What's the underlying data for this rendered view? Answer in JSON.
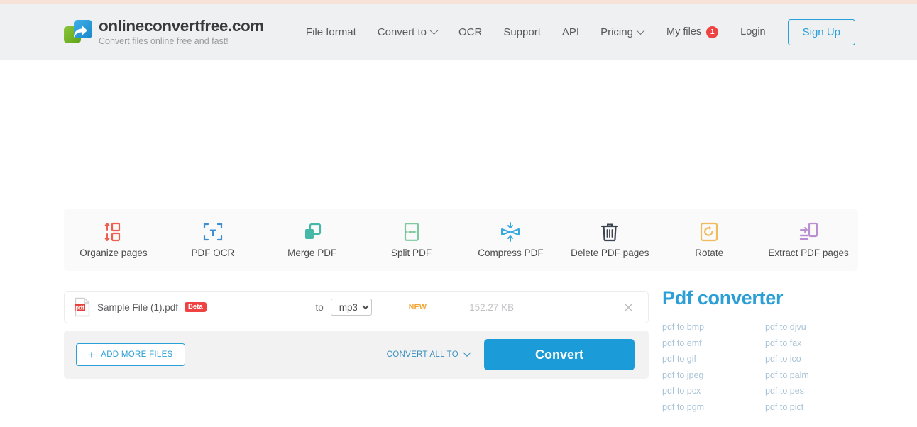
{
  "header": {
    "logo": {
      "title": "onlineconvertfree.com",
      "tagline": "Convert files online free and fast!",
      "icon": "share-arrow-logo-icon"
    },
    "nav": [
      {
        "label": "File format",
        "has_caret": false
      },
      {
        "label": "Convert to",
        "has_caret": true
      },
      {
        "label": "OCR",
        "has_caret": false
      },
      {
        "label": "Support",
        "has_caret": false
      },
      {
        "label": "API",
        "has_caret": false
      },
      {
        "label": "Pricing",
        "has_caret": true
      }
    ],
    "my_files_label": "My files",
    "my_files_count": "1",
    "login_label": "Login",
    "signup_label": "Sign Up",
    "accent_color": "#29a0d8",
    "badge_color": "#ef4243",
    "background_color": "#eff0f2",
    "top_strip_color": "#f7e2d9"
  },
  "tools": [
    {
      "label": "Organize pages",
      "icon": "organize-pages-icon",
      "color": "#ef5e4e"
    },
    {
      "label": "PDF OCR",
      "icon": "pdf-ocr-icon",
      "color": "#3d8fd1"
    },
    {
      "label": "Merge PDF",
      "icon": "merge-pdf-icon",
      "color": "#45b8a8"
    },
    {
      "label": "Split PDF",
      "icon": "split-pdf-icon",
      "color": "#7fc8a0"
    },
    {
      "label": "Compress PDF",
      "icon": "compress-pdf-icon",
      "color": "#36a9e1"
    },
    {
      "label": "Delete PDF pages",
      "icon": "trash-icon",
      "color": "#3c4450"
    },
    {
      "label": "Rotate",
      "icon": "rotate-icon",
      "color": "#f0bc5e"
    },
    {
      "label": "Extract PDF pages",
      "icon": "extract-pdf-pages-icon",
      "color": "#b98fcf"
    }
  ],
  "file_row": {
    "file_icon": "pdf-file-icon",
    "file_name": "Sample File (1).pdf",
    "beta_label": "Beta",
    "to_label": "to",
    "selected_format": "mp3",
    "format_options": [
      "mp3"
    ],
    "new_tag": "NEW",
    "file_size": "152.27 KB",
    "remove_icon": "close-icon"
  },
  "action_bar": {
    "add_more_files_label": "ADD MORE FILES",
    "add_icon": "plus-icon",
    "convert_all_to_label": "CONVERT ALL TO",
    "convert_all_caret": "chevron-down-icon",
    "convert_label": "Convert",
    "convert_button_color": "#1b9cd8"
  },
  "right_panel": {
    "title": "Pdf converter",
    "links": [
      "pdf to bmp",
      "pdf to djvu",
      "pdf to emf",
      "pdf to fax",
      "pdf to gif",
      "pdf to ico",
      "pdf to jpeg",
      "pdf to palm",
      "pdf to pcx",
      "pdf to pes",
      "pdf to pgm",
      "pdf to pict"
    ]
  }
}
